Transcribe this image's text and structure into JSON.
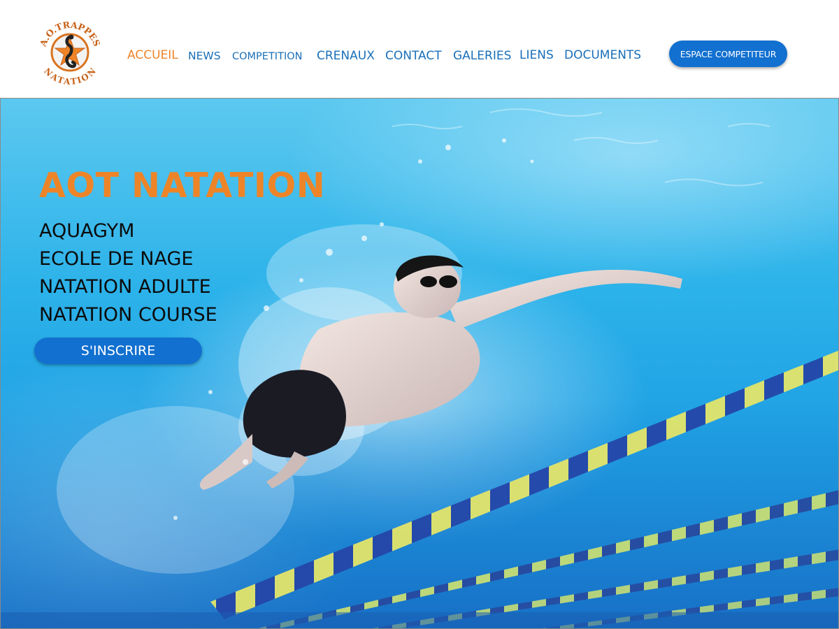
{
  "brand": {
    "logo_icon": "seahorse-star-emblem-icon",
    "logo_top_text": "A.O.TRAPPES",
    "logo_bottom_text": "NATATION"
  },
  "nav": {
    "items": [
      {
        "label": "ACCUEIL",
        "active": true
      },
      {
        "label": "NEWS",
        "active": false
      },
      {
        "label": "COMPETITION",
        "active": false
      },
      {
        "label": "CRENAUX",
        "active": false
      },
      {
        "label": "CONTACT",
        "active": false
      },
      {
        "label": "GALERIES",
        "active": false
      },
      {
        "label": "LIENS",
        "active": false
      },
      {
        "label": "DOCUMENTS",
        "active": false
      }
    ],
    "competitor_button": "ESPACE COMPETITEUR"
  },
  "hero": {
    "background_image": "swimmer-underwater-pool-photo",
    "title": "AOT NATATION",
    "programs": [
      "AQUAGYM",
      "ECOLE DE NAGE",
      "NATATION ADULTE",
      "NATATION COURSE"
    ],
    "register_button": "S'INSCRIRE"
  },
  "colors": {
    "accent_orange": "#ee8428",
    "nav_blue": "#1a6fb8",
    "button_blue": "#1170d0",
    "pool_blue": "#2db3ea"
  }
}
